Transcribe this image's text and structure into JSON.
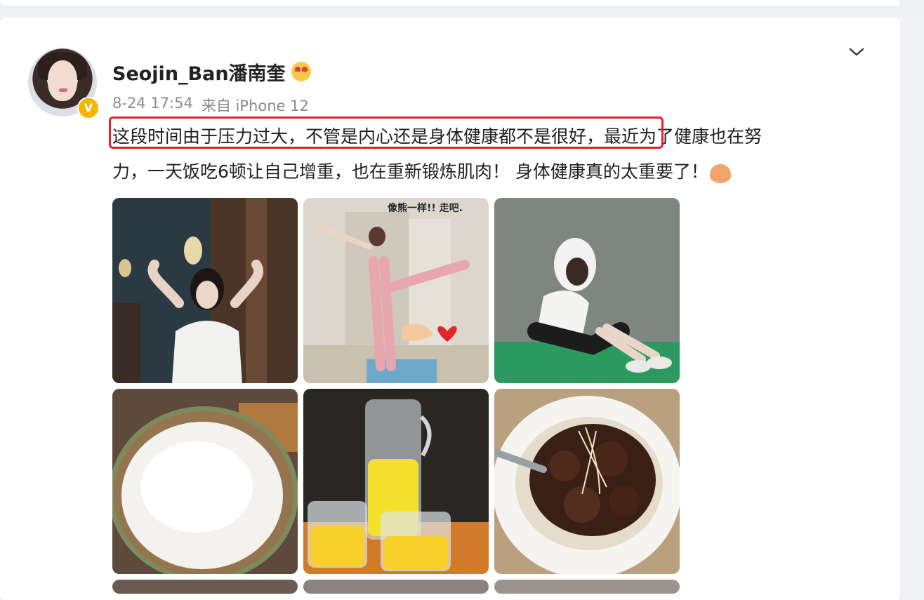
{
  "post": {
    "username": "Seojin_Ban潘南奎",
    "username_emoji": "heart-eyes-face",
    "date": "8-24 17:54",
    "source": "来自 iPhone 12",
    "text_line1_highlighted": "这段时间由于压力过大，不管是内心还是身体健康都不是很好，",
    "text_line1_rest": "最近为了健康也在努",
    "text_line2": "力，一天饭吃6顿让自己增重，也在重新锻炼肌肉！ 身体健康真的太重要了！",
    "text_end_emoji": "clap-hands",
    "verified_badge": "V",
    "photo_caption_partial": "像熊一样!! 走吧."
  },
  "photos": [
    {
      "name": "photo-restaurant-pose",
      "label": ""
    },
    {
      "name": "photo-stretching",
      "label": ""
    },
    {
      "name": "photo-gym-sitting",
      "label": ""
    },
    {
      "name": "photo-rice-bowl",
      "label": ""
    },
    {
      "name": "photo-orange-juice",
      "label": ""
    },
    {
      "name": "photo-braised-meat",
      "label": ""
    }
  ],
  "colors": {
    "highlight_box": "#e0222d",
    "verified": "#f5b400",
    "meta_text": "#8a8a8a"
  }
}
